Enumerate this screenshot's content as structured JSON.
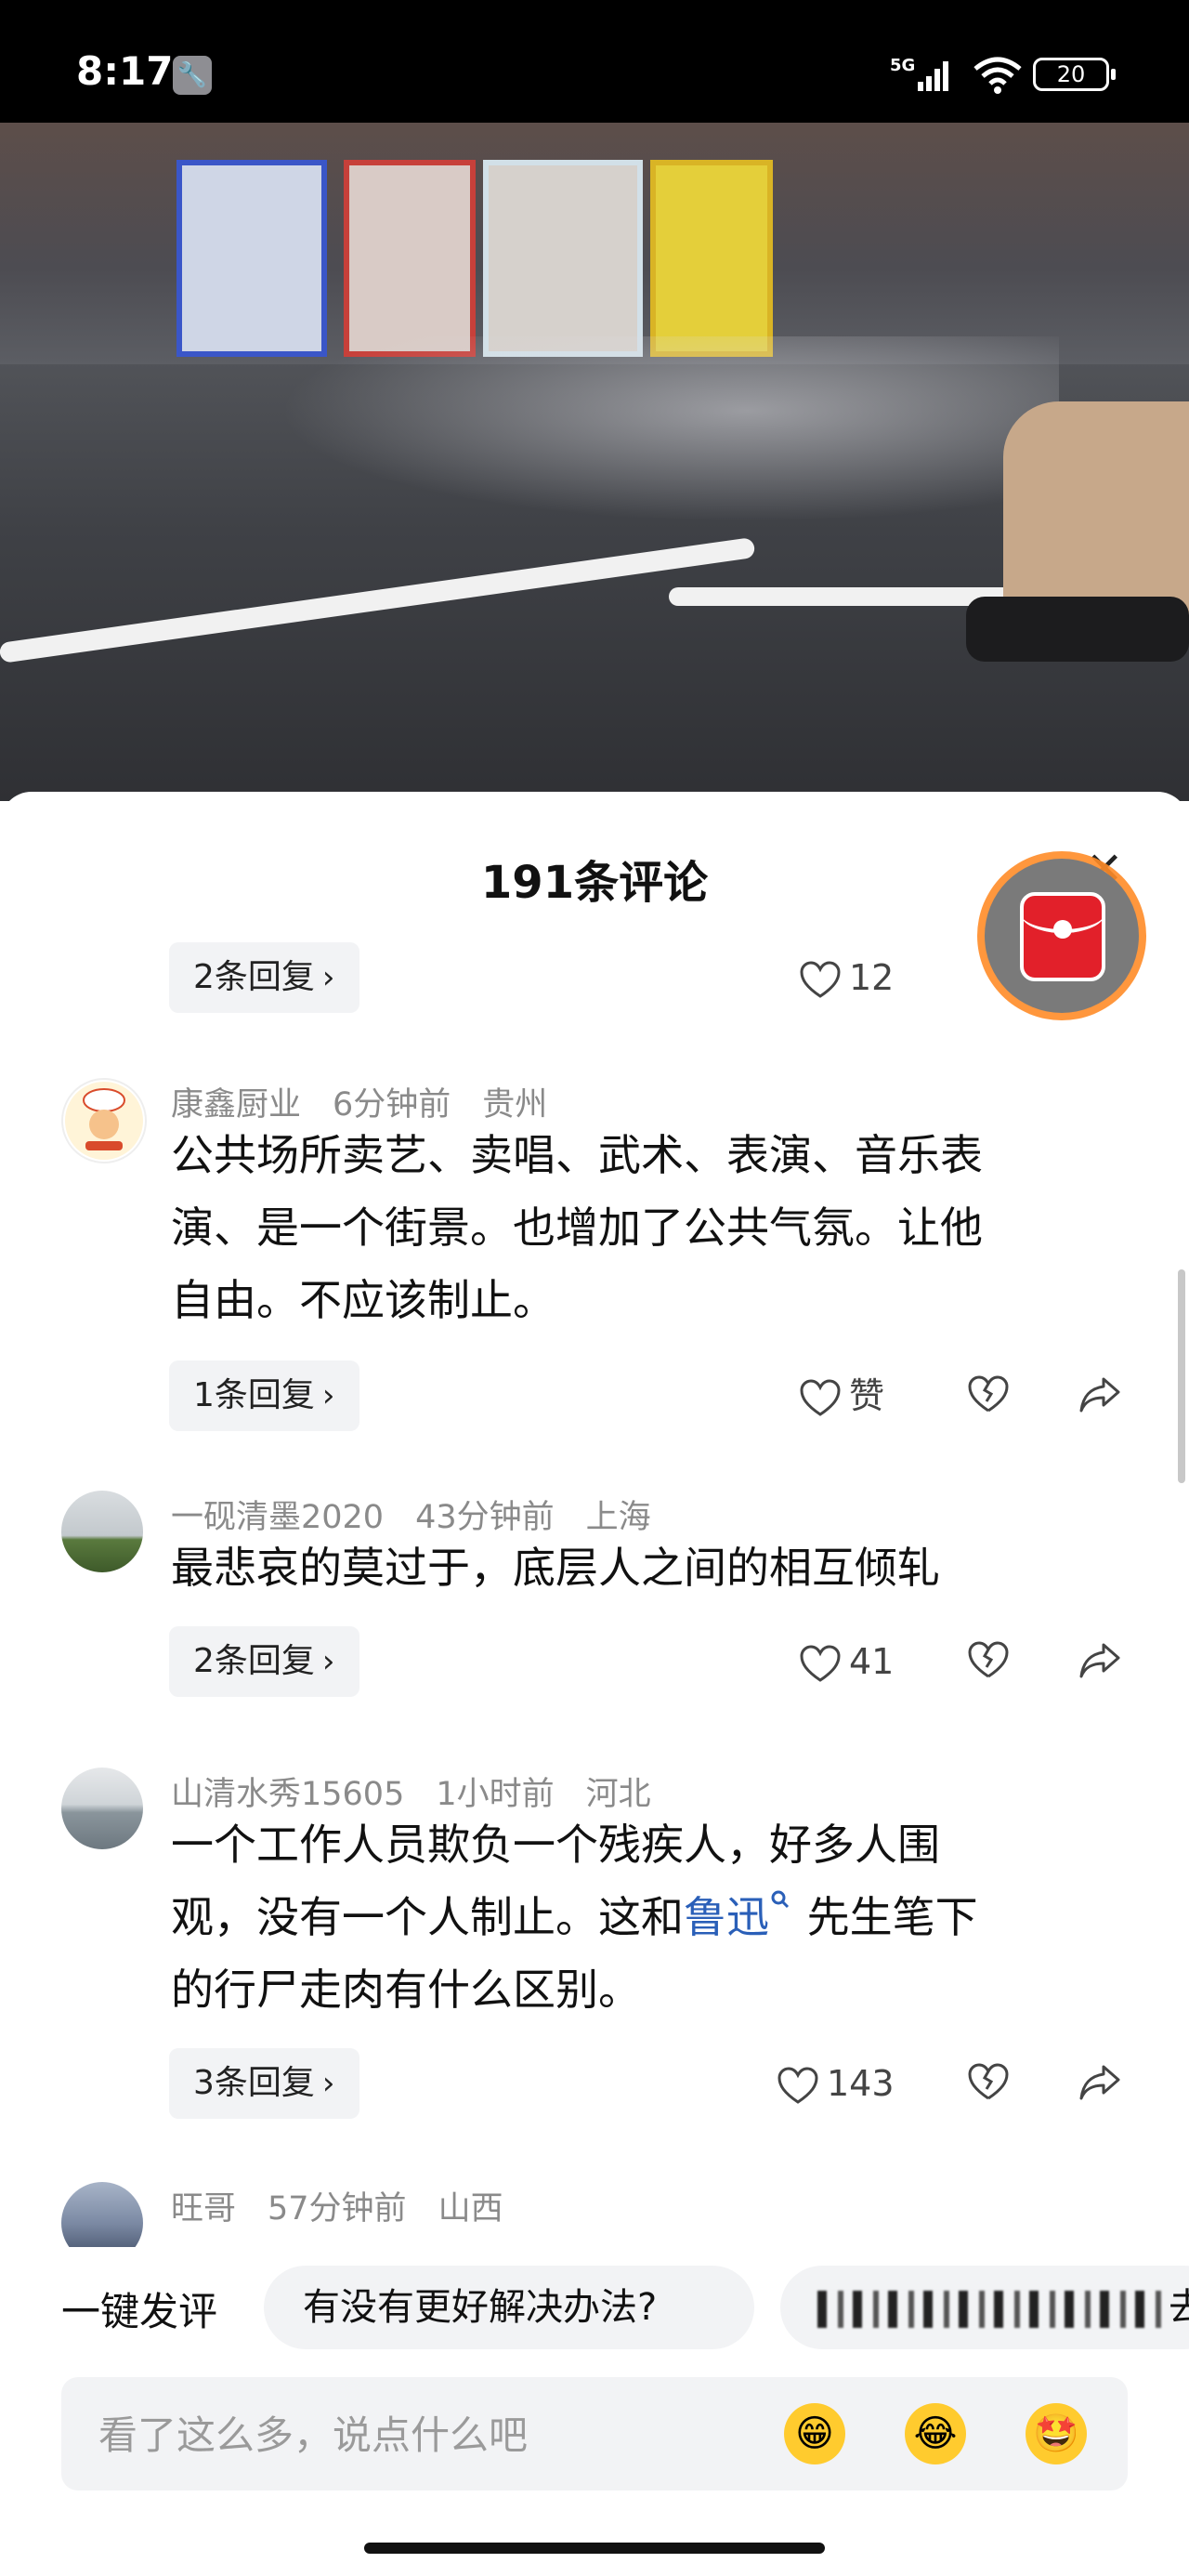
{
  "status_bar": {
    "time": "8:17",
    "network": "5G",
    "battery": "20"
  },
  "sheet": {
    "title": "191条评论"
  },
  "top_reply": {
    "reply_label": "2条回复",
    "likes": "12"
  },
  "comments": [
    {
      "user": "康鑫厨业",
      "time": "6分钟前",
      "location": "贵州",
      "lines": [
        "公共场所卖艺、卖唱、武术、表演、音乐表",
        "演、是一个街景。也增加了公共气氛。让他",
        "自由。不应该制止。"
      ],
      "reply_label": "1条回复",
      "likes": "赞"
    },
    {
      "user": "一砚清墨2020",
      "time": "43分钟前",
      "location": "上海",
      "lines": [
        "最悲哀的莫过于，底层人之间的相互倾轧"
      ],
      "reply_label": "2条回复",
      "likes": "41"
    },
    {
      "user": "山清水秀15605",
      "time": "1小时前",
      "location": "河北",
      "line1": "一个工作人员欺负一个残疾人，好多人围",
      "line2_pre": "观，没有一个人制止。这和",
      "line2_link": "鲁迅",
      "line2_post": " 先生笔下",
      "line3": "的行尸走肉有什么区别。",
      "reply_label": "3条回复",
      "likes": "143"
    },
    {
      "user": "旺哥",
      "time": "57分钟前",
      "location": "山西"
    }
  ],
  "quick_reply": {
    "label": "一键发评",
    "chip1": "有没有更好解决办法?",
    "chip2_tail": "去"
  },
  "input": {
    "placeholder": "看了这么多，说点什么吧"
  },
  "emojis": [
    "😁",
    "😂",
    "🤩"
  ]
}
